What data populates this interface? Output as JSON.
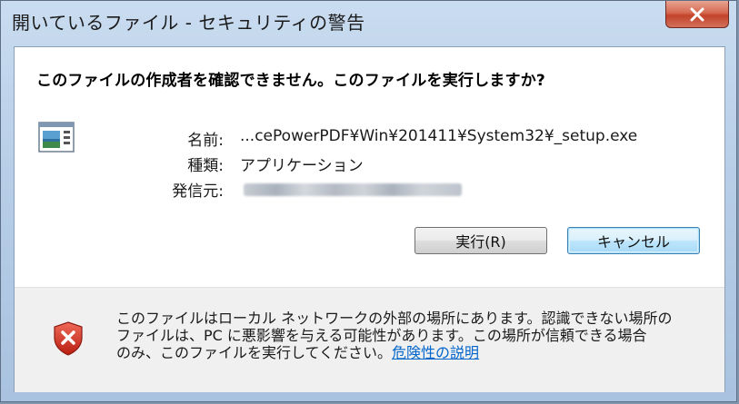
{
  "window": {
    "title": "開いているファイル - セキュリティの警告"
  },
  "dialog": {
    "heading": "このファイルの作成者を確認できません。このファイルを実行しますか?",
    "fields": {
      "name_label": "名前:",
      "name_value": "...cePowerPDF¥Win¥201411¥System32¥_setup.exe",
      "type_label": "種類:",
      "type_value": "アプリケーション",
      "from_label": "発信元:"
    },
    "buttons": {
      "run": "実行(R)",
      "cancel": "キャンセル"
    }
  },
  "footer": {
    "line1": "このファイルはローカル ネットワークの外部の場所にあります。認識できない場所の",
    "line2": "ファイルは、PC に悪影響を与える可能性があります。この場所が信頼できる場合",
    "line3_prefix": "のみ、このファイルを実行してください。",
    "risk_link": "危険性の説明"
  },
  "icons": {
    "close": "close-icon",
    "app": "application-icon",
    "shield": "security-shield-warning-icon"
  },
  "colors": {
    "link": "#0066cc",
    "close_button": "#c2432a",
    "focused_button_border": "#3c7fb1"
  }
}
